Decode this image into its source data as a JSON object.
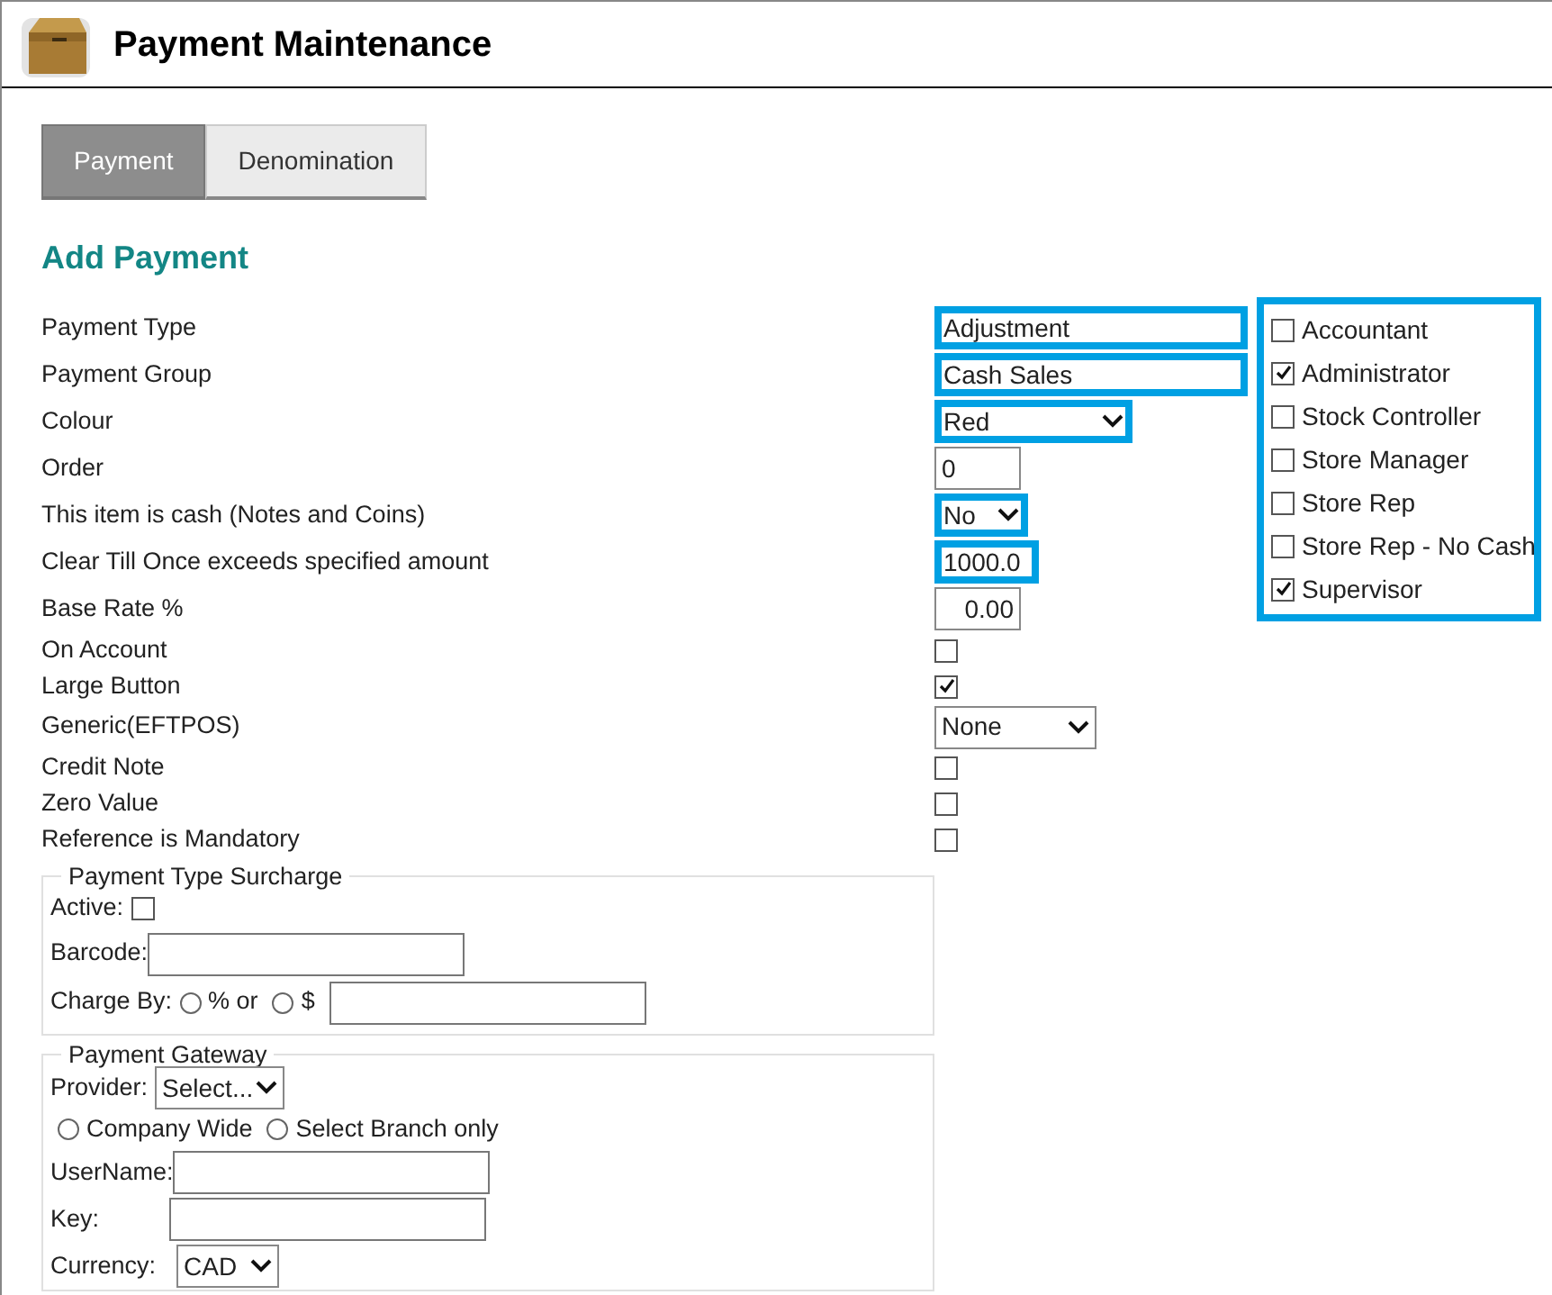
{
  "header": {
    "title": "Payment Maintenance"
  },
  "tabs": [
    {
      "label": "Payment",
      "selected": true
    },
    {
      "label": "Denomination",
      "selected": false
    }
  ],
  "section_title": "Add Payment",
  "fields": [
    {
      "kind": "text",
      "label": "Payment Type",
      "value": "Adjustment",
      "highlighted": true
    },
    {
      "kind": "text",
      "label": "Payment Group",
      "value": "Cash Sales",
      "highlighted": true
    },
    {
      "kind": "select",
      "label": "Colour",
      "value": "Red",
      "highlighted": true
    },
    {
      "kind": "text",
      "label": "Order",
      "value": "0",
      "highlighted": false
    },
    {
      "kind": "select",
      "label": "This item is cash (Notes and Coins)",
      "value": "No",
      "highlighted": true
    },
    {
      "kind": "text",
      "label": "Clear Till Once exceeds specified amount",
      "value": "1000.0",
      "highlighted": true
    },
    {
      "kind": "number",
      "label": "Base Rate %",
      "value": "0.00",
      "highlighted": false
    },
    {
      "kind": "checkbox",
      "label": "On Account",
      "checked": false
    },
    {
      "kind": "checkbox",
      "label": "Large Button",
      "checked": true
    },
    {
      "kind": "select",
      "label": "Generic(EFTPOS)",
      "value": "None",
      "highlighted": false
    },
    {
      "kind": "checkbox",
      "label": "Credit Note",
      "checked": false
    },
    {
      "kind": "checkbox",
      "label": "Zero Value",
      "checked": false
    },
    {
      "kind": "checkbox",
      "label": "Reference is Mandatory",
      "checked": false
    }
  ],
  "roles": {
    "highlighted": true,
    "items": [
      {
        "label": "Accountant",
        "checked": false
      },
      {
        "label": "Administrator",
        "checked": true
      },
      {
        "label": "Stock Controller",
        "checked": false
      },
      {
        "label": "Store Manager",
        "checked": false
      },
      {
        "label": "Store Rep",
        "checked": false
      },
      {
        "label": "Store Rep - No Cash",
        "checked": false
      },
      {
        "label": "Supervisor",
        "checked": true
      }
    ]
  },
  "surcharge": {
    "legend": "Payment Type Surcharge",
    "active_label": "Active:",
    "active_checked": false,
    "barcode_label": "Barcode:",
    "charge_label": "Charge By:",
    "options": [
      {
        "label": "% or",
        "selected": false
      },
      {
        "label": "$",
        "selected": false
      }
    ]
  },
  "gateway": {
    "legend": "Payment Gateway",
    "provider_label": "Provider:",
    "provider_value": "Select...",
    "scope_options": [
      {
        "label": "Company Wide",
        "selected": false
      },
      {
        "label": "Select Branch only",
        "selected": false
      }
    ],
    "username_label": "UserName:",
    "key_label": "Key:",
    "currency_label": "Currency:",
    "currency_value": "CAD"
  }
}
